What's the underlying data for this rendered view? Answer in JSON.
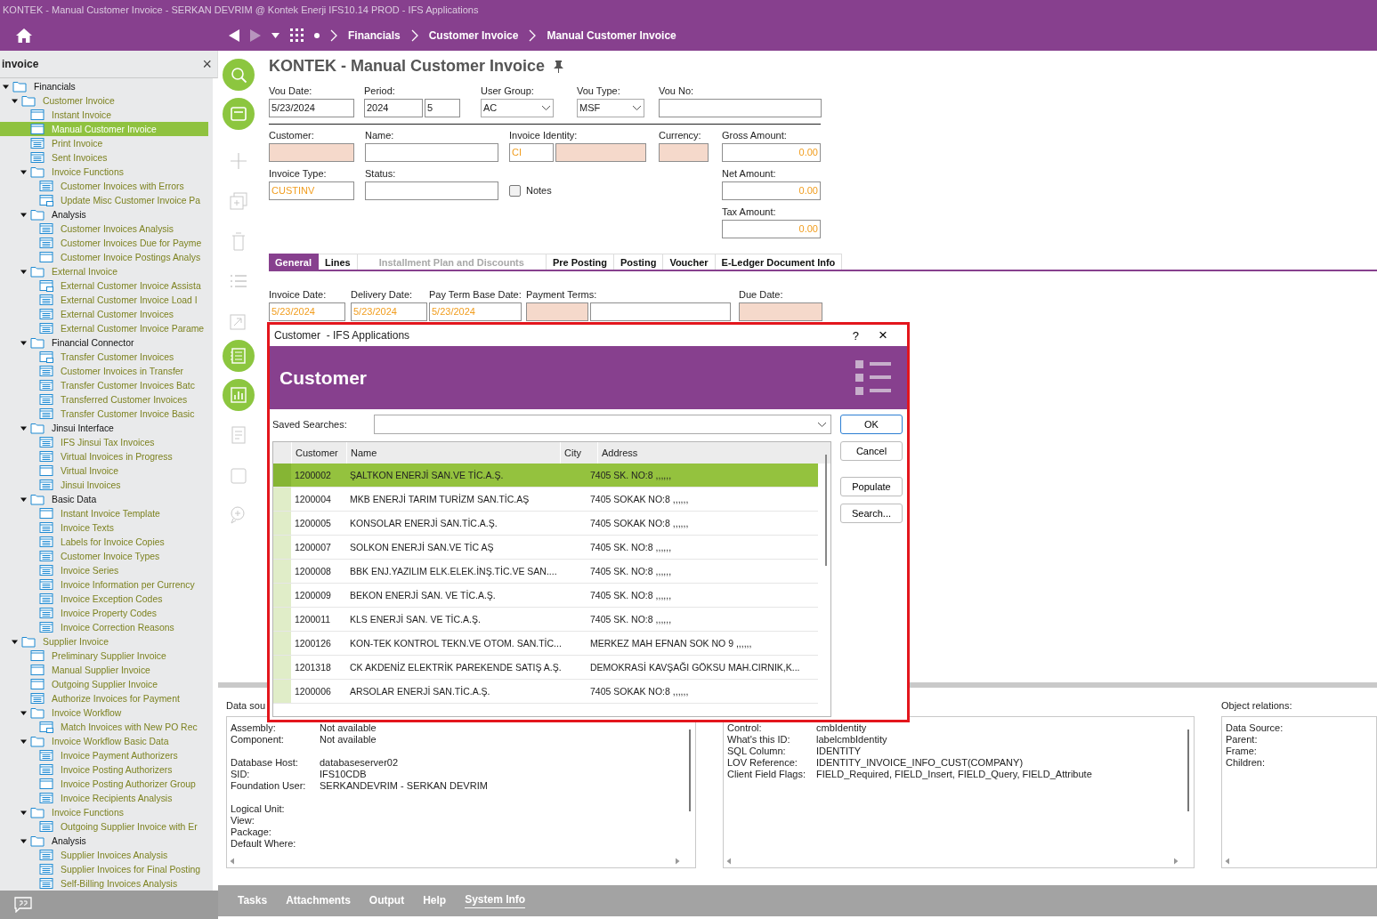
{
  "window": {
    "title": "KONTEK - Manual Customer Invoice - SERKAN DEVRIM @ Kontek Enerji IFS10.14 PROD - IFS Applications"
  },
  "breadcrumb": [
    "Financials",
    "Customer Invoice",
    "Manual Customer Invoice"
  ],
  "navigator": {
    "search": "invoice",
    "close": "×",
    "tree": [
      {
        "label": "Financials",
        "kind": "folder",
        "matched": false,
        "selected": false,
        "expanded": true,
        "children": [
          {
            "label": "Customer Invoice",
            "kind": "folder",
            "matched": true,
            "selected": false,
            "expanded": true,
            "children": [
              {
                "label": "Instant Invoice",
                "kind": "form",
                "matched": true,
                "selected": false
              },
              {
                "label": "Manual Customer Invoice",
                "kind": "form",
                "matched": true,
                "selected": true
              },
              {
                "label": "Print Invoice",
                "kind": "list",
                "matched": true,
                "selected": false
              },
              {
                "label": "Sent Invoices",
                "kind": "list",
                "matched": true,
                "selected": false
              },
              {
                "label": "Invoice Functions",
                "kind": "folder",
                "matched": true,
                "selected": false,
                "expanded": true,
                "children": [
                  {
                    "label": "Customer Invoices with Errors",
                    "kind": "list",
                    "matched": true,
                    "selected": false
                  },
                  {
                    "label": "Update Misc Customer Invoice Pa",
                    "kind": "assistant",
                    "matched": true,
                    "selected": false
                  }
                ]
              },
              {
                "label": "Analysis",
                "kind": "folder",
                "matched": false,
                "selected": false,
                "expanded": true,
                "children": [
                  {
                    "label": "Customer Invoices Analysis",
                    "kind": "list",
                    "matched": true,
                    "selected": false
                  },
                  {
                    "label": "Customer Invoices Due for Payme",
                    "kind": "list",
                    "matched": true,
                    "selected": false
                  },
                  {
                    "label": "Customer Invoice Postings Analys",
                    "kind": "form",
                    "matched": true,
                    "selected": false
                  }
                ]
              },
              {
                "label": "External Invoice",
                "kind": "folder",
                "matched": true,
                "selected": false,
                "expanded": true,
                "children": [
                  {
                    "label": "External Customer Invoice Assista",
                    "kind": "assistant",
                    "matched": true,
                    "selected": false
                  },
                  {
                    "label": "External Customer Invoice Load I",
                    "kind": "list",
                    "matched": true,
                    "selected": false
                  },
                  {
                    "label": "External Customer Invoices",
                    "kind": "list",
                    "matched": true,
                    "selected": false
                  },
                  {
                    "label": "External Customer Invoice Parame",
                    "kind": "list",
                    "matched": true,
                    "selected": false
                  }
                ]
              },
              {
                "label": "Financial Connector",
                "kind": "folder",
                "matched": false,
                "selected": false,
                "expanded": true,
                "children": [
                  {
                    "label": "Transfer Customer Invoices",
                    "kind": "assistant",
                    "matched": true,
                    "selected": false
                  },
                  {
                    "label": "Customer Invoices in Transfer",
                    "kind": "list",
                    "matched": true,
                    "selected": false
                  },
                  {
                    "label": "Transfer Customer Invoices Batc",
                    "kind": "list",
                    "matched": true,
                    "selected": false
                  },
                  {
                    "label": "Transferred Customer Invoices",
                    "kind": "list",
                    "matched": true,
                    "selected": false
                  },
                  {
                    "label": "Transfer Customer Invoice Basic",
                    "kind": "list",
                    "matched": true,
                    "selected": false
                  }
                ]
              },
              {
                "label": "Jinsui Interface",
                "kind": "folder",
                "matched": false,
                "selected": false,
                "expanded": true,
                "children": [
                  {
                    "label": "IFS Jinsui Tax Invoices",
                    "kind": "list",
                    "matched": true,
                    "selected": false
                  },
                  {
                    "label": "Virtual Invoices in Progress",
                    "kind": "list",
                    "matched": true,
                    "selected": false
                  },
                  {
                    "label": "Virtual Invoice",
                    "kind": "form",
                    "matched": true,
                    "selected": false
                  },
                  {
                    "label": "Jinsui Invoices",
                    "kind": "list",
                    "matched": true,
                    "selected": false
                  }
                ]
              },
              {
                "label": "Basic Data",
                "kind": "folder",
                "matched": false,
                "selected": false,
                "expanded": true,
                "children": [
                  {
                    "label": "Instant Invoice Template",
                    "kind": "form",
                    "matched": true,
                    "selected": false
                  },
                  {
                    "label": "Invoice Texts",
                    "kind": "list",
                    "matched": true,
                    "selected": false
                  },
                  {
                    "label": "Labels for Invoice Copies",
                    "kind": "list",
                    "matched": true,
                    "selected": false
                  },
                  {
                    "label": "Customer Invoice Types",
                    "kind": "list",
                    "matched": true,
                    "selected": false
                  },
                  {
                    "label": "Invoice Series",
                    "kind": "list",
                    "matched": true,
                    "selected": false
                  },
                  {
                    "label": "Invoice Information per Currency",
                    "kind": "list",
                    "matched": true,
                    "selected": false
                  },
                  {
                    "label": "Invoice Exception Codes",
                    "kind": "list",
                    "matched": true,
                    "selected": false
                  },
                  {
                    "label": "Invoice Property Codes",
                    "kind": "list",
                    "matched": true,
                    "selected": false
                  },
                  {
                    "label": "Invoice Correction Reasons",
                    "kind": "list",
                    "matched": true,
                    "selected": false
                  }
                ]
              }
            ]
          },
          {
            "label": "Supplier Invoice",
            "kind": "folder",
            "matched": true,
            "selected": false,
            "expanded": true,
            "children": [
              {
                "label": "Preliminary Supplier Invoice",
                "kind": "form",
                "matched": true,
                "selected": false
              },
              {
                "label": "Manual Supplier Invoice",
                "kind": "form",
                "matched": true,
                "selected": false
              },
              {
                "label": "Outgoing Supplier Invoice",
                "kind": "form",
                "matched": true,
                "selected": false
              },
              {
                "label": "Authorize Invoices for Payment",
                "kind": "list",
                "matched": true,
                "selected": false
              },
              {
                "label": "Invoice Workflow",
                "kind": "folder",
                "matched": true,
                "selected": false,
                "expanded": true,
                "children": [
                  {
                    "label": "Match Invoices with New PO Rec",
                    "kind": "assistant",
                    "matched": true,
                    "selected": false
                  }
                ]
              },
              {
                "label": "Invoice Workflow Basic Data",
                "kind": "folder",
                "matched": true,
                "selected": false,
                "expanded": true,
                "children": [
                  {
                    "label": "Invoice Payment Authorizers",
                    "kind": "list",
                    "matched": true,
                    "selected": false
                  },
                  {
                    "label": "Invoice Posting Authorizers",
                    "kind": "list",
                    "matched": true,
                    "selected": false
                  },
                  {
                    "label": "Invoice Posting Authorizer Group",
                    "kind": "form",
                    "matched": true,
                    "selected": false
                  },
                  {
                    "label": "Invoice Recipients Analysis",
                    "kind": "list",
                    "matched": true,
                    "selected": false
                  }
                ]
              },
              {
                "label": "Invoice Functions",
                "kind": "folder",
                "matched": true,
                "selected": false,
                "expanded": true,
                "children": [
                  {
                    "label": "Outgoing Supplier Invoice with Er",
                    "kind": "list",
                    "matched": true,
                    "selected": false
                  }
                ]
              },
              {
                "label": "Analysis",
                "kind": "folder",
                "matched": false,
                "selected": false,
                "expanded": true,
                "children": [
                  {
                    "label": "Supplier Invoices Analysis",
                    "kind": "list",
                    "matched": true,
                    "selected": false
                  },
                  {
                    "label": "Supplier Invoices for Final Posting",
                    "kind": "list",
                    "matched": true,
                    "selected": false
                  },
                  {
                    "label": "Self-Billing Invoices Analysis",
                    "kind": "list",
                    "matched": true,
                    "selected": false
                  }
                ]
              }
            ]
          }
        ]
      }
    ]
  },
  "page": {
    "title": "KONTEK - Manual Customer Invoice",
    "header_rows": [
      [
        {
          "kind": "field",
          "label": "Vou Date:",
          "inputs": [
            {
              "kind": "text",
              "value": "5/23/2024",
              "required": false,
              "defaulted": false
            }
          ]
        },
        {
          "kind": "field",
          "label": "Period:",
          "inputs": [
            {
              "kind": "text",
              "value": "2024",
              "required": false,
              "defaulted": false
            },
            {
              "kind": "text",
              "value": "5",
              "required": false,
              "defaulted": false
            }
          ]
        },
        {
          "kind": "field",
          "label": "User Group:",
          "inputs": [
            {
              "kind": "combo",
              "value": "AC",
              "required": false,
              "defaulted": false
            }
          ]
        },
        {
          "kind": "field",
          "label": "Vou Type:",
          "inputs": [
            {
              "kind": "combo",
              "value": "MSF",
              "required": false,
              "defaulted": false
            }
          ]
        },
        {
          "kind": "field",
          "label": "Vou No:",
          "inputs": [
            {
              "kind": "text",
              "required": false
            }
          ]
        }
      ],
      [
        {
          "kind": "field",
          "label": "Customer:",
          "inputs": [
            {
              "kind": "text",
              "required": true
            }
          ]
        },
        {
          "kind": "field",
          "label": "Name:",
          "inputs": [
            {
              "kind": "text",
              "required": false
            }
          ]
        },
        {
          "kind": "field",
          "label": "Invoice Identity:",
          "inputs": [
            {
              "kind": "text",
              "value": "CI",
              "required": false,
              "defaulted": true
            },
            {
              "kind": "text",
              "required": true
            }
          ]
        },
        {
          "kind": "field",
          "label": "Currency:",
          "inputs": [
            {
              "kind": "text",
              "required": true
            }
          ]
        },
        {
          "kind": "field",
          "label": "Gross Amount:",
          "inputs": [
            {
              "kind": "amount",
              "value": "0.00",
              "required": false,
              "defaulted": true
            }
          ]
        }
      ],
      [
        {
          "kind": "field",
          "label": "Invoice Type:",
          "inputs": [
            {
              "kind": "text",
              "value": "CUSTINV",
              "required": false,
              "defaulted": true
            }
          ]
        },
        {
          "kind": "field",
          "label": "Status:",
          "inputs": [
            {
              "kind": "text",
              "required": false
            }
          ]
        },
        {
          "kind": "checkbox",
          "label": "Notes",
          "checked": false
        },
        {
          "kind": "field",
          "label": "Net Amount:",
          "inputs": [
            {
              "kind": "amount",
              "value": "0.00",
              "required": false,
              "defaulted": true
            }
          ]
        }
      ],
      [
        {
          "kind": "field",
          "label": "Tax Amount:",
          "inputs": [
            {
              "kind": "amount",
              "value": "0.00",
              "required": false,
              "defaulted": true
            }
          ]
        }
      ]
    ],
    "tabs": [
      {
        "label": "General",
        "selected": true,
        "disabled": false
      },
      {
        "label": "Lines",
        "selected": false,
        "disabled": false
      },
      {
        "label": "Installment Plan and Discounts",
        "selected": false,
        "disabled": true
      },
      {
        "label": "Pre Posting",
        "selected": false,
        "disabled": false
      },
      {
        "label": "Posting",
        "selected": false,
        "disabled": false
      },
      {
        "label": "Voucher",
        "selected": false,
        "disabled": false
      },
      {
        "label": "E-Ledger Document Info",
        "selected": false,
        "disabled": false
      }
    ],
    "tab_fields": [
      {
        "kind": "field",
        "label": "Invoice Date:",
        "inputs": [
          {
            "kind": "text",
            "value": "5/23/2024",
            "required": false,
            "defaulted": true
          }
        ]
      },
      {
        "kind": "field",
        "label": "Delivery Date:",
        "inputs": [
          {
            "kind": "text",
            "value": "5/23/2024",
            "required": false,
            "defaulted": true
          }
        ]
      },
      {
        "kind": "field",
        "label": "Pay Term Base Date:",
        "inputs": [
          {
            "kind": "text",
            "value": "5/23/2024",
            "required": false,
            "defaulted": true
          }
        ]
      },
      {
        "kind": "field",
        "label": "Payment Terms:",
        "inputs": [
          {
            "kind": "text",
            "required": true
          },
          {
            "kind": "text",
            "required": false
          }
        ]
      },
      {
        "kind": "field",
        "label": "Due Date:",
        "inputs": [
          {
            "kind": "text",
            "required": true
          }
        ]
      }
    ]
  },
  "dialog": {
    "title": "Customer  - IFS Applications",
    "help": "?",
    "close": "×",
    "heading": "Customer",
    "saved_searches_label": "Saved Searches:",
    "buttons": [
      {
        "label": "OK",
        "default": true
      },
      {
        "label": "Cancel",
        "default": false
      },
      {
        "label": "Populate",
        "default": false
      },
      {
        "label": "Search...",
        "default": false
      }
    ],
    "columns": [
      "Customer",
      "Name",
      "City",
      "Address"
    ],
    "rows": [
      {
        "customer": "1200002",
        "name": "ŞALTKON ENERJİ SAN.VE TİC.A.Ş.",
        "address": "7405 SK. NO:8 ,,,,,,",
        "selected": true
      },
      {
        "customer": "1200004",
        "name": "MKB ENERJİ TARIM TURİZM SAN.TİC.AŞ",
        "address": "7405 SOKAK NO:8 ,,,,,,",
        "selected": false
      },
      {
        "customer": "1200005",
        "name": "KONSOLAR ENERJİ SAN.TİC.A.Ş.",
        "address": "7405 SOKAK NO:8 ,,,,,,",
        "selected": false
      },
      {
        "customer": "1200007",
        "name": "SOLKON ENERJİ SAN.VE TİC AŞ",
        "address": "7405 SK. NO:8 ,,,,,,",
        "selected": false
      },
      {
        "customer": "1200008",
        "name": "BBK ENJ.YAZILIM ELK.ELEK.İNŞ.TİC.VE SAN....",
        "address": "7405 SK. NO:8 ,,,,,,",
        "selected": false
      },
      {
        "customer": "1200009",
        "name": "BEKON ENERJİ SAN. VE TİC.A.Ş.",
        "address": "7405 SK. NO:8 ,,,,,,",
        "selected": false
      },
      {
        "customer": "1200011",
        "name": "KLS ENERJİ SAN. VE TİC.A.Ş.",
        "address": "7405 SK. NO:8 ,,,,,,",
        "selected": false
      },
      {
        "customer": "1200126",
        "name": "KON-TEK KONTROL TEKN.VE OTOM. SAN.TİC...",
        "address": "MERKEZ MAH EFNAN SOK NO 9 ,,,,,,",
        "selected": false
      },
      {
        "customer": "1201318",
        "name": "CK AKDENİZ ELEKTRİK PAREKENDE SATIŞ A.Ş.",
        "address": "DEMOKRASİ KAVŞAĞI GÖKSU MAH.CIRNIK,K...",
        "selected": false
      },
      {
        "customer": "1200006",
        "name": "ARSOLAR ENERJİ SAN.TİC.A.Ş.",
        "address": "7405 SOKAK NO:8 ,,,,,,",
        "selected": false
      }
    ]
  },
  "system_info": {
    "left_label": "Data sou",
    "left_groups": [
      [
        {
          "label": "Assembly:",
          "value": "Not available"
        },
        {
          "label": "Component:",
          "value": "Not available"
        }
      ],
      [
        {
          "label": "Database Host:",
          "value": "databaseserver02"
        },
        {
          "label": "SID:",
          "value": "IFS10CDB"
        },
        {
          "label": "Foundation User:",
          "value": "SERKANDEVRIM - SERKAN DEVRIM"
        }
      ],
      [
        {
          "label": "Logical Unit:"
        },
        {
          "label": "View:"
        },
        {
          "label": "Package:"
        },
        {
          "label": "Default Where:"
        }
      ]
    ],
    "middle_groups": [
      [
        {
          "label": "Control:",
          "value": "cmbIdentity"
        },
        {
          "label": "What's this ID:",
          "value": "labelcmbIdentity"
        },
        {
          "label": "SQL Column:",
          "value": "IDENTITY"
        },
        {
          "label": "LOV Reference:",
          "value": "IDENTITY_INVOICE_INFO_CUST(COMPANY)"
        },
        {
          "label": "Client Field Flags:",
          "value": "FIELD_Required, FIELD_Insert, FIELD_Query, FIELD_Attribute"
        }
      ]
    ],
    "right_label": "Object relations:",
    "right_items": [
      "Data Source:",
      "Parent:",
      "Frame:",
      "Children:"
    ]
  },
  "bottom_tabs": [
    {
      "label": "Tasks",
      "selected": false
    },
    {
      "label": "Attachments",
      "selected": false
    },
    {
      "label": "Output",
      "selected": false
    },
    {
      "label": "Help",
      "selected": false
    },
    {
      "label": "System Info",
      "selected": true
    }
  ]
}
